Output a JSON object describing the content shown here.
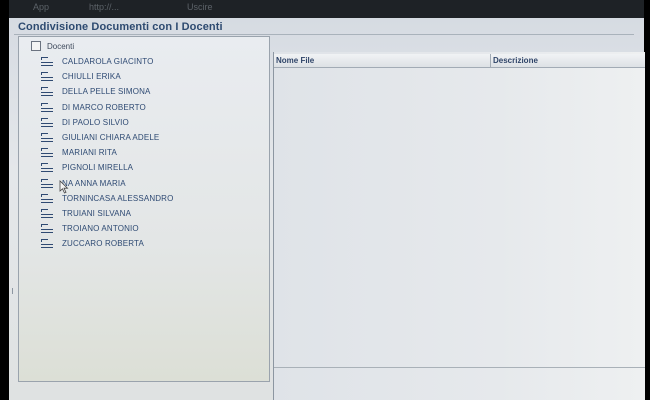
{
  "browser_bar": {
    "apps_label": "App",
    "address_text": "http://...",
    "extra_text": "Uscire"
  },
  "app_title": "Condivisione Documenti con I Docenti",
  "tree": {
    "root_label": "Docenti",
    "items": [
      {
        "label": "CALDAROLA GIACINTO"
      },
      {
        "label": "CHIULLI ERIKA"
      },
      {
        "label": "DELLA PELLE SIMONA"
      },
      {
        "label": "DI MARCO ROBERTO"
      },
      {
        "label": "DI PAOLO SILVIO"
      },
      {
        "label": "GIULIANI CHIARA ADELE"
      },
      {
        "label": "MARIANI RITA"
      },
      {
        "label": "PIGNOLI MIRELLA"
      },
      {
        "label": "NA ANNA MARIA"
      },
      {
        "label": "TORNINCASA ALESSANDRO"
      },
      {
        "label": "TRUIANI SILVANA"
      },
      {
        "label": "TROIANO ANTONIO"
      },
      {
        "label": "ZUCCARO ROBERTA"
      }
    ]
  },
  "file_table": {
    "columns": [
      {
        "label": "Nome File"
      },
      {
        "label": "Descrizione"
      }
    ]
  },
  "icons": {
    "folder": "folder-icon",
    "cursor": "mouse-cursor-icon"
  },
  "colors": {
    "title": "#2d4a70",
    "tree_text": "#2e4a73"
  }
}
